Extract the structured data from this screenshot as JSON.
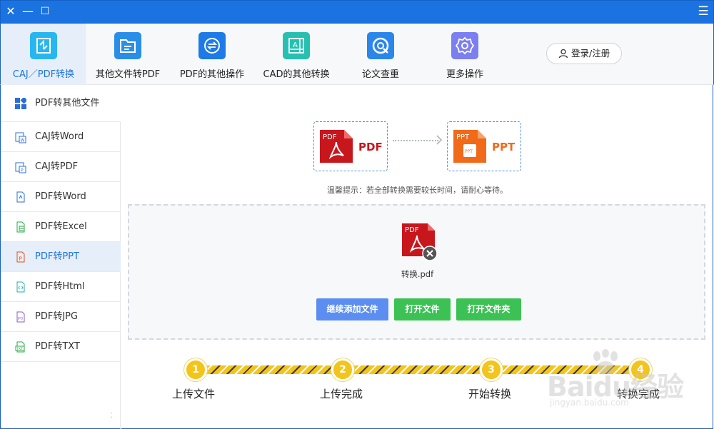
{
  "window": {
    "close_glyph": "✕",
    "minimize_glyph": "—",
    "maximize_glyph": "☐",
    "menu_glyph": "☰"
  },
  "topnav": {
    "items": [
      {
        "label": "CAJ／PDF转换",
        "icon": "caj-pdf-convert-icon",
        "color": "#27b6ef",
        "active": true
      },
      {
        "label": "其他文件转PDF",
        "icon": "folder-icon",
        "color": "#2a8ee8",
        "active": false
      },
      {
        "label": "PDF的其他操作",
        "icon": "swap-icon",
        "color": "#1d7ae6",
        "active": false
      },
      {
        "label": "CAD的其他转换",
        "icon": "cad-icon",
        "color": "#27c0b0",
        "active": false
      },
      {
        "label": "论文查重",
        "icon": "search-circle-icon",
        "color": "#2a86ea",
        "active": false
      },
      {
        "label": "更多操作",
        "icon": "gear-icon",
        "color": "#7b7ff0",
        "active": false
      }
    ],
    "login_label": "登录/注册"
  },
  "sidebar": {
    "header": "PDF转其他文件",
    "items": [
      {
        "label": "CAJ转Word",
        "icon": "caj-word-icon"
      },
      {
        "label": "CAJ转PDF",
        "icon": "caj-pdf-icon"
      },
      {
        "label": "PDF转Word",
        "icon": "pdf-word-icon"
      },
      {
        "label": "PDF转Excel",
        "icon": "pdf-excel-icon"
      },
      {
        "label": "PDF转PPT",
        "icon": "pdf-ppt-icon",
        "active": true
      },
      {
        "label": "PDF转Html",
        "icon": "pdf-html-icon"
      },
      {
        "label": "PDF转JPG",
        "icon": "pdf-jpg-icon"
      },
      {
        "label": "PDF转TXT",
        "icon": "pdf-txt-icon"
      }
    ]
  },
  "conversion": {
    "from_label": "PDF",
    "from_badge": "PDF",
    "to_label": "PPT",
    "to_badge": "PPT",
    "to_sub": "PPT",
    "from_color": "#c8161d",
    "to_color": "#f06a1a"
  },
  "tip": "温馨提示：若全部转换需要较长时间，请耐心等待。",
  "dropzone": {
    "file_badge": "PDF",
    "file_name": "转换.pdf",
    "buttons": {
      "add_more": "继续添加文件",
      "open_file": "打开文件",
      "open_folder": "打开文件夹"
    }
  },
  "steps": [
    {
      "num": "1",
      "label": "上传文件"
    },
    {
      "num": "2",
      "label": "上传完成"
    },
    {
      "num": "3",
      "label": "开始转换"
    },
    {
      "num": "4",
      "label": "转换完成"
    }
  ],
  "watermark": {
    "big": "Baidu经验",
    "small": "jingyan.baidu.com"
  }
}
